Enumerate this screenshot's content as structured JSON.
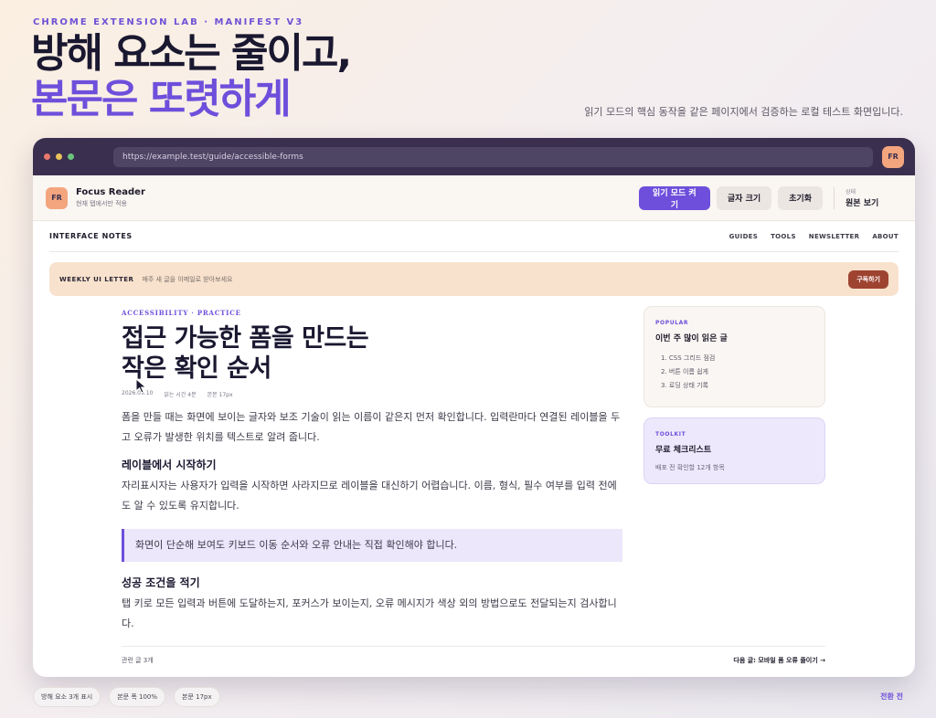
{
  "hero": {
    "eyebrow": "CHROME EXTENSION LAB · MANIFEST V3",
    "title_line1": "방해 요소는 줄이고,",
    "title_line2": "본문은 또렷하게",
    "description": "읽기 모드의 핵심 동작을 같은 페이지에서 검증하는 로컬 테스트 화면입니다."
  },
  "browser": {
    "url": "https://example.test/guide/accessible-forms",
    "avatar": "FR"
  },
  "extension": {
    "logo": "FR",
    "name": "Focus Reader",
    "subtitle": "현재 탭에서만 적용",
    "buttons": {
      "reading_mode": "읽기 모드 켜기",
      "font_size": "글자 크기",
      "reset": "초기화"
    },
    "status_label": "상태",
    "status_value": "원본 보기"
  },
  "site": {
    "logo": "INTERFACE NOTES",
    "nav": [
      "GUIDES",
      "TOOLS",
      "NEWSLETTER",
      "ABOUT"
    ]
  },
  "newsletter": {
    "title": "WEEKLY UI LETTER",
    "description": "매주 새 글을 이메일로 받아보세요",
    "button": "구독하기"
  },
  "article": {
    "eyebrow": "ACCESSIBILITY · PRACTICE",
    "title_line1": "접근 가능한 폼을 만드는",
    "title_line2": "작은 확인 순서",
    "meta": {
      "date": "2026.09.10",
      "read_time": "읽는 시간 4분",
      "body_size": "본문 17px"
    },
    "paragraph1": "폼을 만들 때는 화면에 보이는 글자와 보조 기술이 읽는 이름이 같은지 먼저 확인합니다. 입력란마다 연결된 레이블을 두고 오류가 발생한 위치를 텍스트로 알려 줍니다.",
    "heading1": "레이블에서 시작하기",
    "paragraph2": "자리표시자는 사용자가 입력을 시작하면 사라지므로 레이블을 대신하기 어렵습니다. 이름, 형식, 필수 여부를 입력 전에도 알 수 있도록 유지합니다.",
    "callout": "화면이 단순해 보여도 키보드 이동 순서와 오류 안내는 직접 확인해야 합니다.",
    "heading2": "성공 조건을 적기",
    "paragraph3": "탭 키로 모든 입력과 버튼에 도달하는지, 포커스가 보이는지, 오류 메시지가 색상 외의 방법으로도 전달되는지 검사합니다.",
    "related": "관련 글 3개",
    "next": "다음 글: 모바일 폼 오류 줄이기 →"
  },
  "sidebar": {
    "popular": {
      "eyebrow": "POPULAR",
      "title": "이번 주 많이 읽은 글",
      "items": [
        "1. CSS 그리드 점검",
        "2. 버튼 이름 쉽게",
        "3. 로딩 상태 기록"
      ]
    },
    "toolkit": {
      "eyebrow": "TOOLKIT",
      "title": "무료 체크리스트",
      "subtitle": "배포 전 확인할 12개 항목"
    }
  },
  "footer": {
    "chips": [
      "방해 요소 3개 표시",
      "본문 폭 100%",
      "본문 17px"
    ],
    "state": "전환 전"
  },
  "colors": {
    "accent": "#6e4fdb",
    "chrome": "#3a2f4f",
    "newsletter_bg": "#f8e2cd",
    "subscribe": "#9f4331"
  }
}
